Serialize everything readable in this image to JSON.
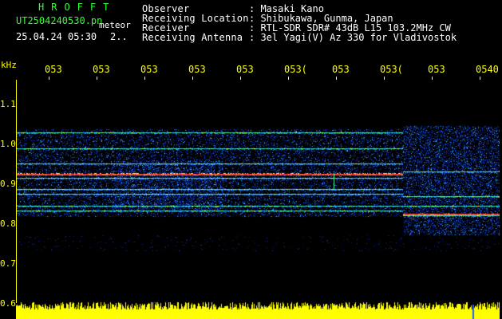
{
  "header": {
    "logo": "HROFFT",
    "filename": "UT2504240530.pn",
    "mode": "meteor",
    "datetime": "25.04.24 05:30",
    "counter": "2..",
    "labels": {
      "observer": "Observer",
      "location": "Receiving Location",
      "receiver": "Receiver",
      "antenna": "Receiving Antenna"
    },
    "values": {
      "observer": ": Masaki Kano",
      "location": ": Shibukawa, Gunma, Japan",
      "receiver": ": RTL-SDR SDR# 43dB L15 103.2MHz CW",
      "antenna": ": 3el Yagi(V) Az 330 for Vladivostok"
    }
  },
  "axis": {
    "unit": "kHz",
    "time_ticks": [
      "053",
      "053",
      "053",
      "053",
      "053",
      "053(",
      "053",
      "053(",
      "053",
      "0540"
    ],
    "freq_ticks": [
      "1.1",
      "1.0",
      "0.9",
      "0.8",
      "0.7",
      "0.6"
    ]
  },
  "colors": {
    "background": "#000000",
    "header_green": "#33ff33",
    "header_white": "#ffffff",
    "axis_yellow": "#ffff00",
    "signal_red": "#ff3030"
  }
}
